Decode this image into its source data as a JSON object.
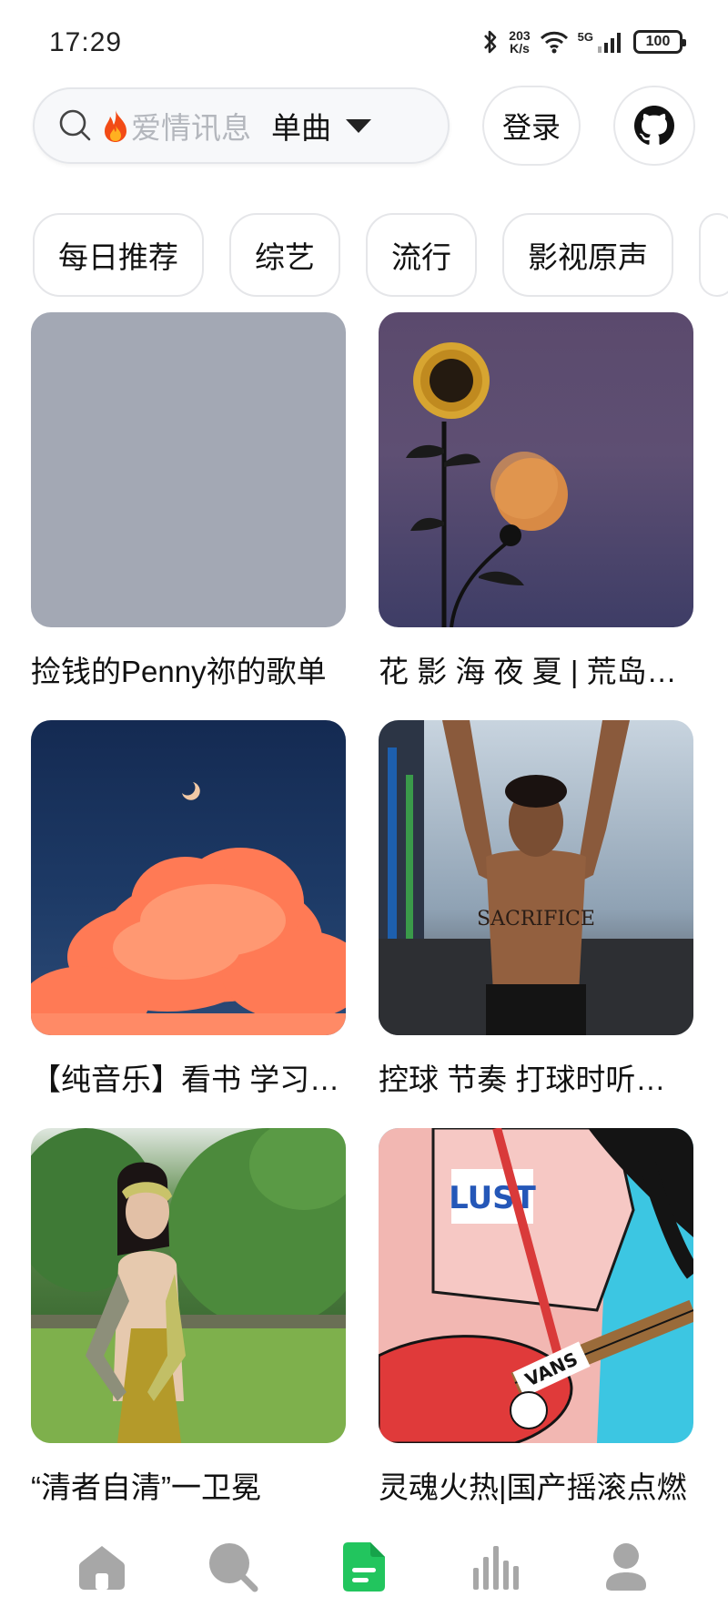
{
  "status_bar": {
    "time": "17:29",
    "net_speed_value": "203",
    "net_speed_unit": "K/s",
    "network_type": "5G",
    "battery": "100"
  },
  "search": {
    "hot_icon": "fire-icon",
    "placeholder": "爱情讯息",
    "type_label": "单曲",
    "login_label": "登录",
    "github_icon": "github-icon"
  },
  "categories": [
    {
      "label": "每日推荐"
    },
    {
      "label": "综艺"
    },
    {
      "label": "流行"
    },
    {
      "label": "影视原声"
    }
  ],
  "playlists": [
    {
      "title": "捡钱的Penny祢的歌单"
    },
    {
      "title": "花 影 海 夜 夏 | 荒岛人间 氛围音乐"
    },
    {
      "title": "【纯音乐】看书 学习 工作"
    },
    {
      "title": "控球 节奏 打球时听的歌"
    },
    {
      "title": "“清者自清”一卫冕"
    },
    {
      "title": "灵魂火热|国产摇滚点燃"
    }
  ],
  "bottom_nav": {
    "items": [
      "home-icon",
      "search-icon",
      "playlist-icon",
      "chart-icon",
      "user-icon"
    ],
    "active_color": "#22c55e",
    "inactive_color": "#a7a7a7"
  }
}
